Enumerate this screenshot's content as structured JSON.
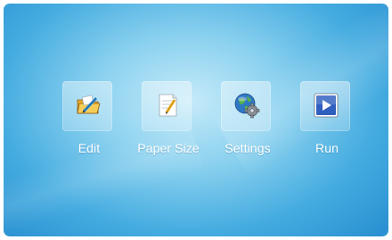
{
  "menu": {
    "items": [
      {
        "label": "Edit",
        "icon": "folder-pencil-icon"
      },
      {
        "label": "Paper Size",
        "icon": "document-pencil-icon"
      },
      {
        "label": "Settings",
        "icon": "globe-gear-icon"
      },
      {
        "label": "Run",
        "icon": "play-icon"
      }
    ]
  },
  "colors": {
    "background_center": "#c6ebf9",
    "background_edge": "#2a92d2",
    "label": "#ffffff",
    "run_icon": "#2f5fbf"
  }
}
